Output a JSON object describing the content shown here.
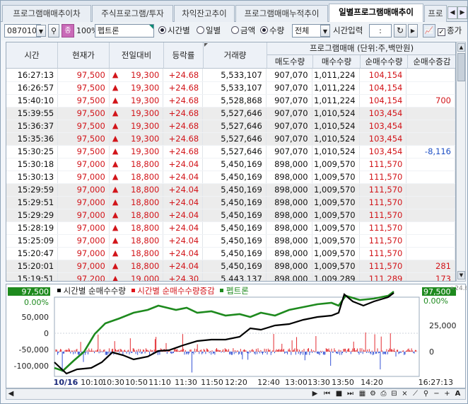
{
  "tabs": [
    {
      "label": "프로그램매매추이차"
    },
    {
      "label": "주식프로그램/투자"
    },
    {
      "label": "차익잔고추이"
    },
    {
      "label": "프로그램매매누적추이"
    },
    {
      "label": "일별프로그램매매추이"
    },
    {
      "label": "프로"
    }
  ],
  "toolbar": {
    "code": "087010",
    "badge": "종",
    "pct": "100%",
    "stock_name": "펩트론",
    "radio_time": "시간별",
    "radio_day": "일별",
    "radio_amount": "금액",
    "radio_qty": "수량",
    "filter": "전체",
    "time_input_label": "시간입력",
    "time_value": ":",
    "chk_label": "종가"
  },
  "grid": {
    "headers": {
      "time": "시간",
      "price": "현재가",
      "change": "전일대비",
      "rate": "등락률",
      "volume": "거래량",
      "program": "프로그램매매 (단위:주,백만원)",
      "sell": "매도수량",
      "buy": "매수수량",
      "net": "순매수수량",
      "net_delta": "순매수증감"
    },
    "rows": [
      {
        "time": "16:27:13",
        "price": "97,500",
        "change": "19,300",
        "rate": "+24.68",
        "volume": "5,533,107",
        "sell": "907,070",
        "buy": "1,011,224",
        "net": "104,154",
        "delta": "",
        "alt": false
      },
      {
        "time": "16:26:57",
        "price": "97,500",
        "change": "19,300",
        "rate": "+24.68",
        "volume": "5,533,107",
        "sell": "907,070",
        "buy": "1,011,224",
        "net": "104,154",
        "delta": "",
        "alt": false
      },
      {
        "time": "15:40:10",
        "price": "97,500",
        "change": "19,300",
        "rate": "+24.68",
        "volume": "5,528,868",
        "sell": "907,070",
        "buy": "1,011,224",
        "net": "104,154",
        "delta": "700",
        "alt": false
      },
      {
        "time": "15:39:55",
        "price": "97,500",
        "change": "19,300",
        "rate": "+24.68",
        "volume": "5,527,646",
        "sell": "907,070",
        "buy": "1,010,524",
        "net": "103,454",
        "delta": "",
        "alt": true
      },
      {
        "time": "15:36:37",
        "price": "97,500",
        "change": "19,300",
        "rate": "+24.68",
        "volume": "5,527,646",
        "sell": "907,070",
        "buy": "1,010,524",
        "net": "103,454",
        "delta": "",
        "alt": true
      },
      {
        "time": "15:35:36",
        "price": "97,500",
        "change": "19,300",
        "rate": "+24.68",
        "volume": "5,527,646",
        "sell": "907,070",
        "buy": "1,010,524",
        "net": "103,454",
        "delta": "",
        "alt": true
      },
      {
        "time": "15:30:25",
        "price": "97,500",
        "change": "19,300",
        "rate": "+24.68",
        "volume": "5,527,646",
        "sell": "907,070",
        "buy": "1,010,524",
        "net": "103,454",
        "delta": "-8,116",
        "alt": false
      },
      {
        "time": "15:30:18",
        "price": "97,000",
        "change": "18,800",
        "rate": "+24.04",
        "volume": "5,450,169",
        "sell": "898,000",
        "buy": "1,009,570",
        "net": "111,570",
        "delta": "",
        "alt": false
      },
      {
        "time": "15:30:13",
        "price": "97,000",
        "change": "18,800",
        "rate": "+24.04",
        "volume": "5,450,169",
        "sell": "898,000",
        "buy": "1,009,570",
        "net": "111,570",
        "delta": "",
        "alt": false
      },
      {
        "time": "15:29:59",
        "price": "97,000",
        "change": "18,800",
        "rate": "+24.04",
        "volume": "5,450,169",
        "sell": "898,000",
        "buy": "1,009,570",
        "net": "111,570",
        "delta": "",
        "alt": true
      },
      {
        "time": "15:29:51",
        "price": "97,000",
        "change": "18,800",
        "rate": "+24.04",
        "volume": "5,450,169",
        "sell": "898,000",
        "buy": "1,009,570",
        "net": "111,570",
        "delta": "",
        "alt": true
      },
      {
        "time": "15:29:29",
        "price": "97,000",
        "change": "18,800",
        "rate": "+24.04",
        "volume": "5,450,169",
        "sell": "898,000",
        "buy": "1,009,570",
        "net": "111,570",
        "delta": "",
        "alt": true
      },
      {
        "time": "15:28:19",
        "price": "97,000",
        "change": "18,800",
        "rate": "+24.04",
        "volume": "5,450,169",
        "sell": "898,000",
        "buy": "1,009,570",
        "net": "111,570",
        "delta": "",
        "alt": false
      },
      {
        "time": "15:25:09",
        "price": "97,000",
        "change": "18,800",
        "rate": "+24.04",
        "volume": "5,450,169",
        "sell": "898,000",
        "buy": "1,009,570",
        "net": "111,570",
        "delta": "",
        "alt": false
      },
      {
        "time": "15:20:47",
        "price": "97,000",
        "change": "18,800",
        "rate": "+24.04",
        "volume": "5,450,169",
        "sell": "898,000",
        "buy": "1,009,570",
        "net": "111,570",
        "delta": "",
        "alt": false
      },
      {
        "time": "15:20:01",
        "price": "97,000",
        "change": "18,800",
        "rate": "+24.04",
        "volume": "5,450,169",
        "sell": "898,000",
        "buy": "1,009,570",
        "net": "111,570",
        "delta": "281",
        "alt": true
      },
      {
        "time": "15:19:51",
        "price": "97,200",
        "change": "19,000",
        "rate": "+24.30",
        "volume": "5,443,137",
        "sell": "898,000",
        "buy": "1,009,289",
        "net": "111,289",
        "delta": "173",
        "alt": true
      }
    ]
  },
  "chart": {
    "legend": [
      "시간별 순매수수량",
      "시간별 순매수수량증감",
      "펩트론"
    ],
    "left_axis": [
      "97,500",
      "0.00%",
      "50,000",
      "0",
      "-50,000",
      "-100,000"
    ],
    "right_axis": [
      "97,500",
      "0.00%",
      "25,000",
      "0"
    ],
    "x_labels": [
      "10/16",
      "10:10",
      "10:30",
      "10:50",
      "11:10",
      "11:30",
      "11:50",
      "12:20",
      "12:40",
      "13:00",
      "13:30",
      "13:50",
      "14:20"
    ],
    "x_end": "16:27:13",
    "corner": "ㅅ24.68",
    "colors": {
      "net": "#000000",
      "delta_pos": "#e0141a",
      "delta_neg": "#1f3fd0",
      "price": "#1e8a1e",
      "accent": "#0a8a74"
    }
  }
}
